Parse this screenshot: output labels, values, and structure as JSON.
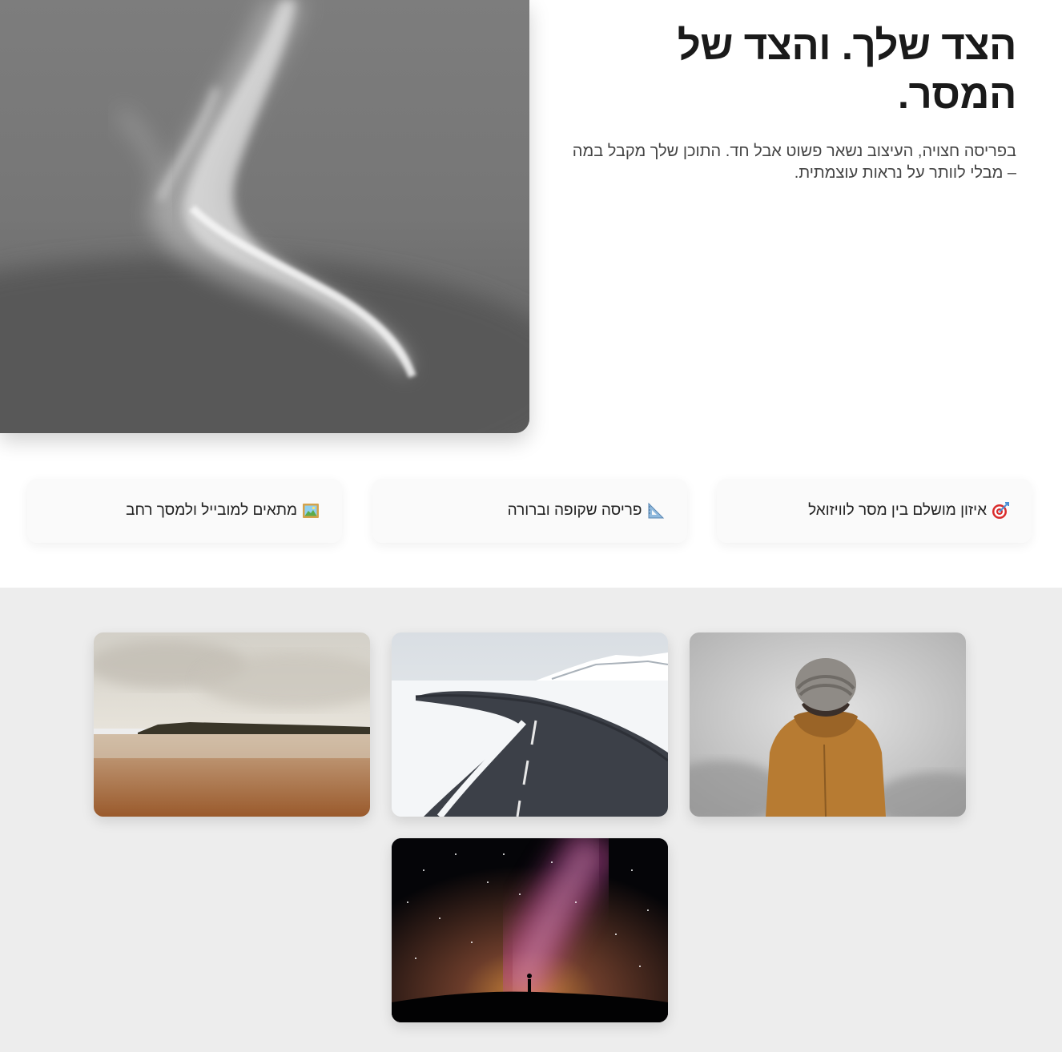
{
  "hero": {
    "title": "הצד שלך. והצד של המסר.",
    "description": "בפריסה חצויה, העיצוב נשאר פשוט אבל חד. התוכן שלך מקבל במה – מבלי לוותר על נראות עוצמתית.",
    "image_alt": "wispy-cloud-photo"
  },
  "features": [
    {
      "icon": "target-icon",
      "label": "איזון מושלם בין מסר לוויזואל"
    },
    {
      "icon": "ruler-triangle-icon",
      "label": "פריסה שקופה וברורה"
    },
    {
      "icon": "framed-picture-icon",
      "label": "מתאים למובייל ולמסך רחב"
    }
  ],
  "gallery": [
    {
      "name": "person-in-fog-photo"
    },
    {
      "name": "snowy-road-photo"
    },
    {
      "name": "beach-reflection-photo"
    },
    {
      "name": "milky-way-photo"
    }
  ]
}
